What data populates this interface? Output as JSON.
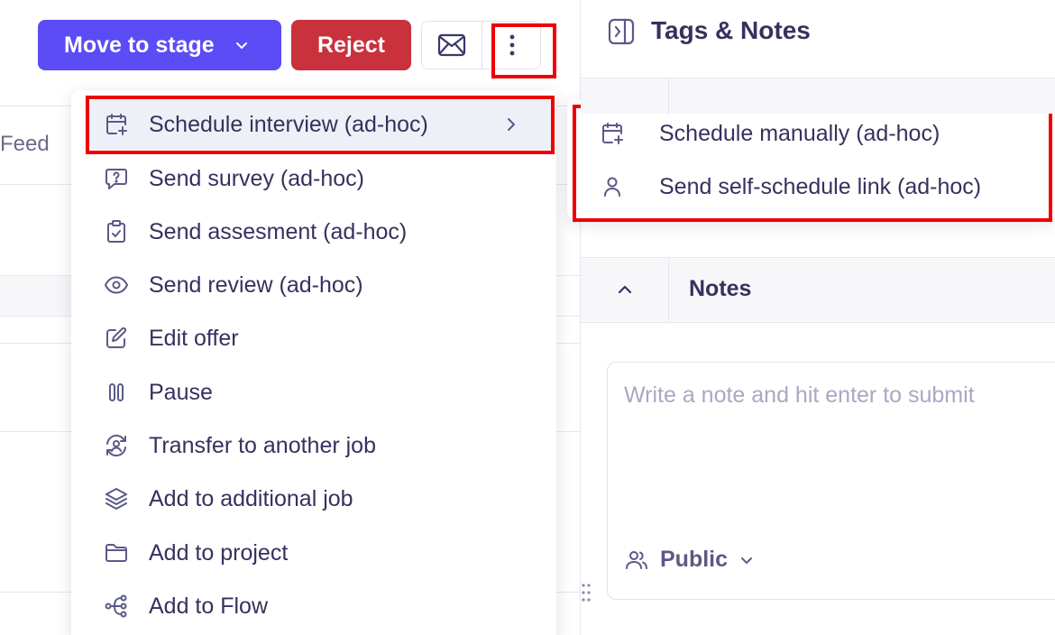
{
  "toolbar": {
    "move_to_stage_label": "Move to stage",
    "reject_label": "Reject"
  },
  "left_pane": {
    "feed_label": "Feed"
  },
  "dropdown": {
    "items": [
      {
        "label": "Schedule interview (ad-hoc)",
        "icon": "calendar-plus-icon",
        "has_submenu": true,
        "active": true
      },
      {
        "label": "Send survey (ad-hoc)",
        "icon": "chat-question-icon"
      },
      {
        "label": "Send assesment (ad-hoc)",
        "icon": "clipboard-check-icon"
      },
      {
        "label": "Send review (ad-hoc)",
        "icon": "eye-icon"
      },
      {
        "label": "Edit offer",
        "icon": "pencil-square-icon"
      },
      {
        "label": "Pause",
        "icon": "pause-icon"
      },
      {
        "label": "Transfer to another job",
        "icon": "user-transfer-icon"
      },
      {
        "label": "Add to additional job",
        "icon": "layers-icon"
      },
      {
        "label": "Add to project",
        "icon": "folder-icon"
      },
      {
        "label": "Add to Flow",
        "icon": "flow-icon"
      }
    ]
  },
  "submenu": {
    "items": [
      {
        "label": "Schedule manually (ad-hoc)",
        "icon": "calendar-plus-icon"
      },
      {
        "label": "Send self-schedule link (ad-hoc)",
        "icon": "user-icon"
      }
    ]
  },
  "right_pane": {
    "title": "Tags & Notes",
    "notes_title": "Notes",
    "note_placeholder": "Write a note and hit enter to submit",
    "visibility_label": "Public"
  },
  "colors": {
    "primary": "#5b4cf5",
    "danger": "#c9313d",
    "text": "#34325e",
    "highlight_box": "#ee0000"
  }
}
